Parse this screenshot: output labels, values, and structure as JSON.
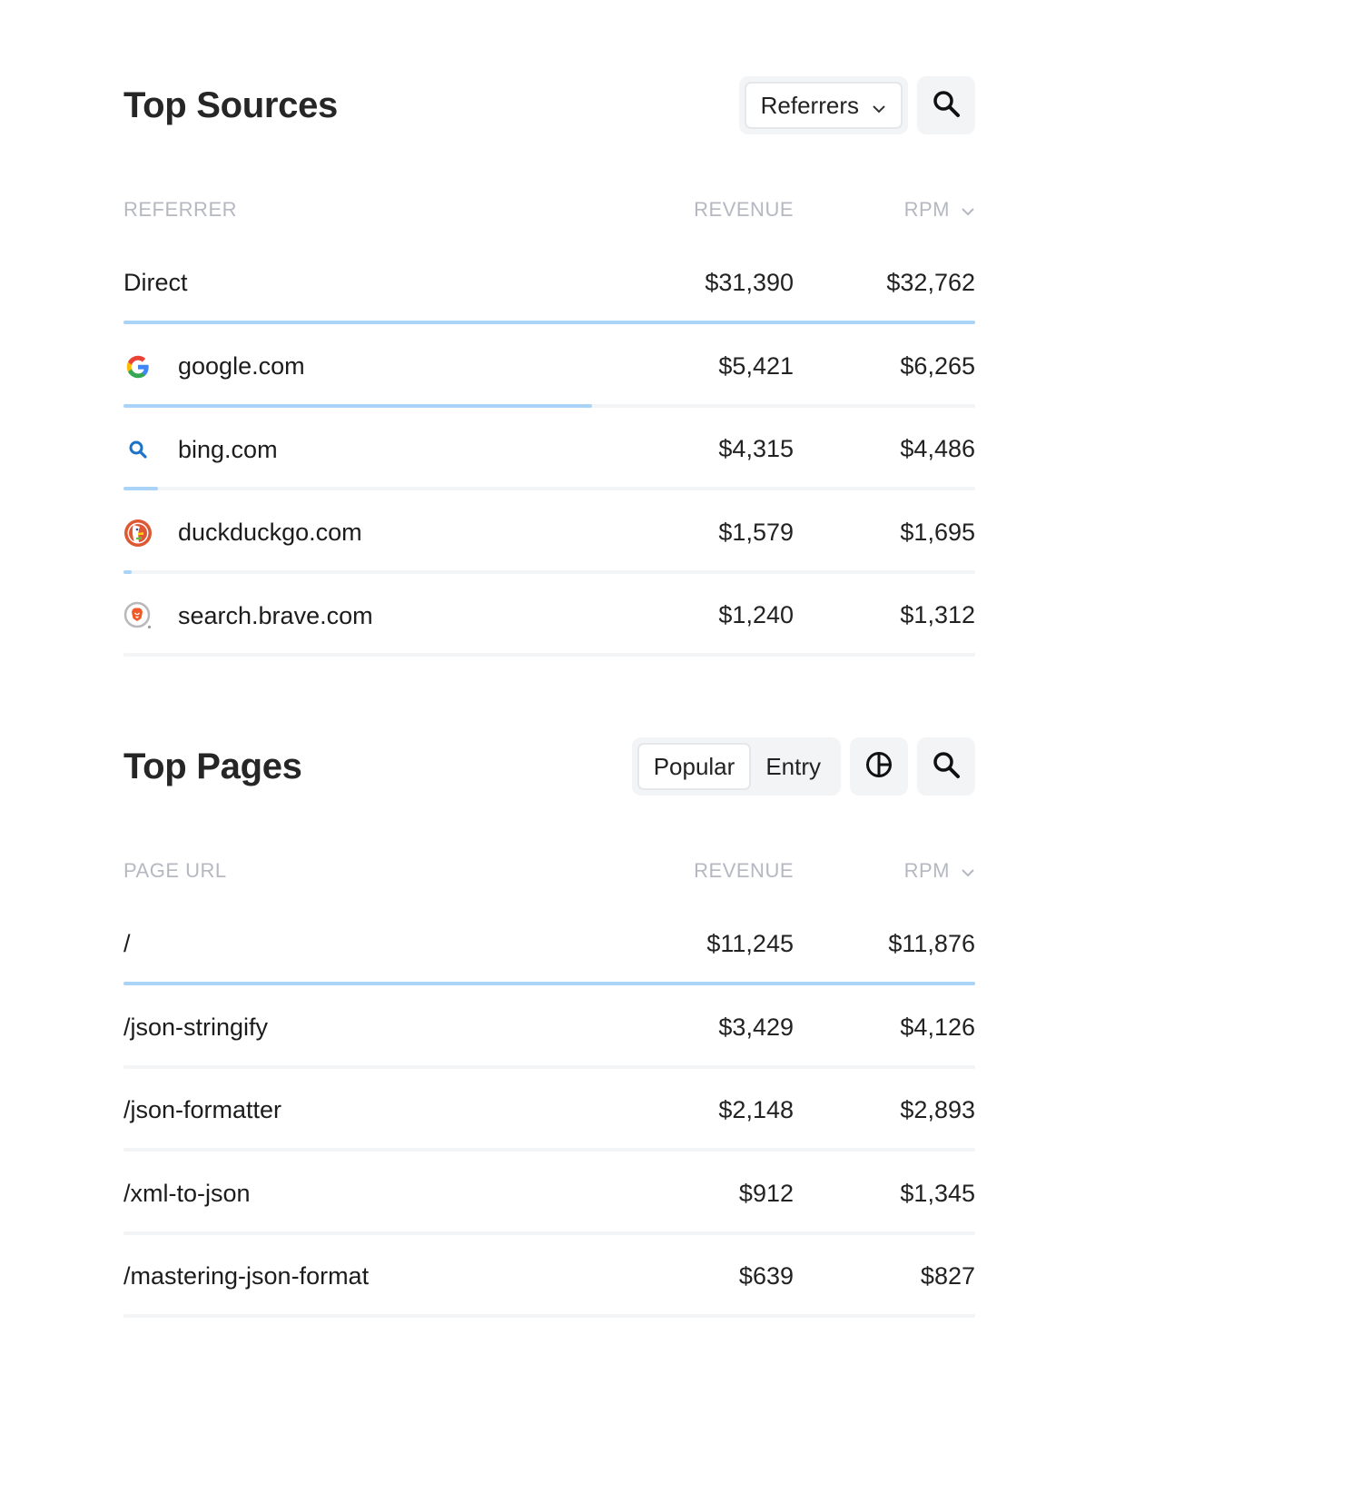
{
  "sources": {
    "title": "Top Sources",
    "dropdown_label": "Referrers",
    "columns": {
      "name": "REFERRER",
      "revenue": "REVENUE",
      "rpm": "RPM"
    },
    "rows": [
      {
        "name": "Direct",
        "icon": "none",
        "revenue": "$31,390",
        "rpm": "$32,762",
        "share": 1.0
      },
      {
        "name": "google.com",
        "icon": "google-icon",
        "revenue": "$5,421",
        "rpm": "$6,265",
        "share": 0.55
      },
      {
        "name": "bing.com",
        "icon": "bing-icon",
        "revenue": "$4,315",
        "rpm": "$4,486",
        "share": 0.04
      },
      {
        "name": "duckduckgo.com",
        "icon": "duckduckgo-icon",
        "revenue": "$1,579",
        "rpm": "$1,695",
        "share": 0.01
      },
      {
        "name": "search.brave.com",
        "icon": "brave-icon",
        "revenue": "$1,240",
        "rpm": "$1,312",
        "share": 0.0
      }
    ]
  },
  "pages": {
    "title": "Top Pages",
    "tabs": [
      {
        "label": "Popular",
        "active": true
      },
      {
        "label": "Entry",
        "active": false
      }
    ],
    "columns": {
      "name": "PAGE URL",
      "revenue": "REVENUE",
      "rpm": "RPM"
    },
    "rows": [
      {
        "name": "/",
        "revenue": "$11,245",
        "rpm": "$11,876",
        "share": 1.0
      },
      {
        "name": "/json-stringify",
        "revenue": "$3,429",
        "rpm": "$4,126",
        "share": 0.0
      },
      {
        "name": "/json-formatter",
        "revenue": "$2,148",
        "rpm": "$2,893",
        "share": 0.0
      },
      {
        "name": "/xml-to-json",
        "revenue": "$912",
        "rpm": "$1,345",
        "share": 0.0
      },
      {
        "name": "/mastering-json-format",
        "revenue": "$639",
        "rpm": "$827",
        "share": 0.0
      }
    ]
  },
  "colors": {
    "bar_fill": "#a9d4f7",
    "bar_track": "#f3f4f6",
    "header_text": "#b5b8c0"
  }
}
